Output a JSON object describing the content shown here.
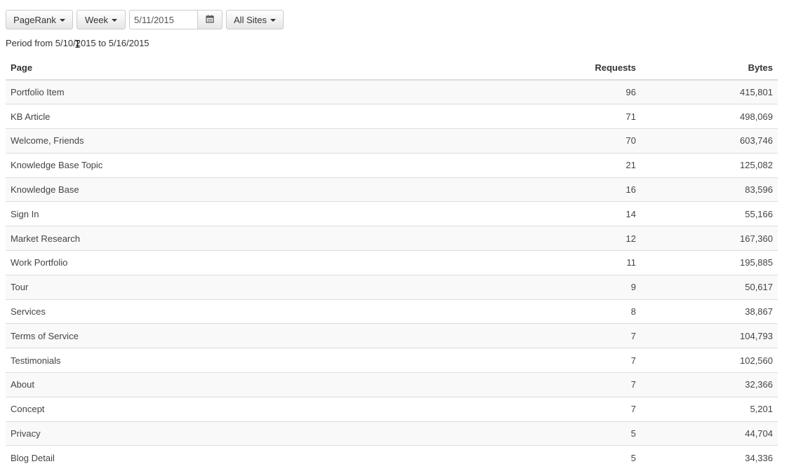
{
  "toolbar": {
    "report_label": "PageRank",
    "period_label": "Week",
    "date_value": "5/11/2015",
    "sites_label": "All Sites"
  },
  "period_text": "Period from 5/10/2015 to 5/16/2015",
  "table": {
    "headers": {
      "page": "Page",
      "requests": "Requests",
      "bytes": "Bytes"
    },
    "rows": [
      {
        "page": "Portfolio Item",
        "requests": "96",
        "bytes": "415,801"
      },
      {
        "page": "KB Article",
        "requests": "71",
        "bytes": "498,069"
      },
      {
        "page": "Welcome, Friends",
        "requests": "70",
        "bytes": "603,746"
      },
      {
        "page": "Knowledge Base Topic",
        "requests": "21",
        "bytes": "125,082"
      },
      {
        "page": "Knowledge Base",
        "requests": "16",
        "bytes": "83,596"
      },
      {
        "page": "Sign In",
        "requests": "14",
        "bytes": "55,166"
      },
      {
        "page": "Market Research",
        "requests": "12",
        "bytes": "167,360"
      },
      {
        "page": "Work Portfolio",
        "requests": "11",
        "bytes": "195,885"
      },
      {
        "page": "Tour",
        "requests": "9",
        "bytes": "50,617"
      },
      {
        "page": "Services",
        "requests": "8",
        "bytes": "38,867"
      },
      {
        "page": "Terms of Service",
        "requests": "7",
        "bytes": "104,793"
      },
      {
        "page": "Testimonials",
        "requests": "7",
        "bytes": "102,560"
      },
      {
        "page": "About",
        "requests": "7",
        "bytes": "32,366"
      },
      {
        "page": "Concept",
        "requests": "7",
        "bytes": "5,201"
      },
      {
        "page": "Privacy",
        "requests": "5",
        "bytes": "44,704"
      },
      {
        "page": "Blog Detail",
        "requests": "5",
        "bytes": "34,336"
      }
    ]
  },
  "icons": {
    "calendar": "calendar-icon",
    "caret": "caret-down-icon"
  }
}
